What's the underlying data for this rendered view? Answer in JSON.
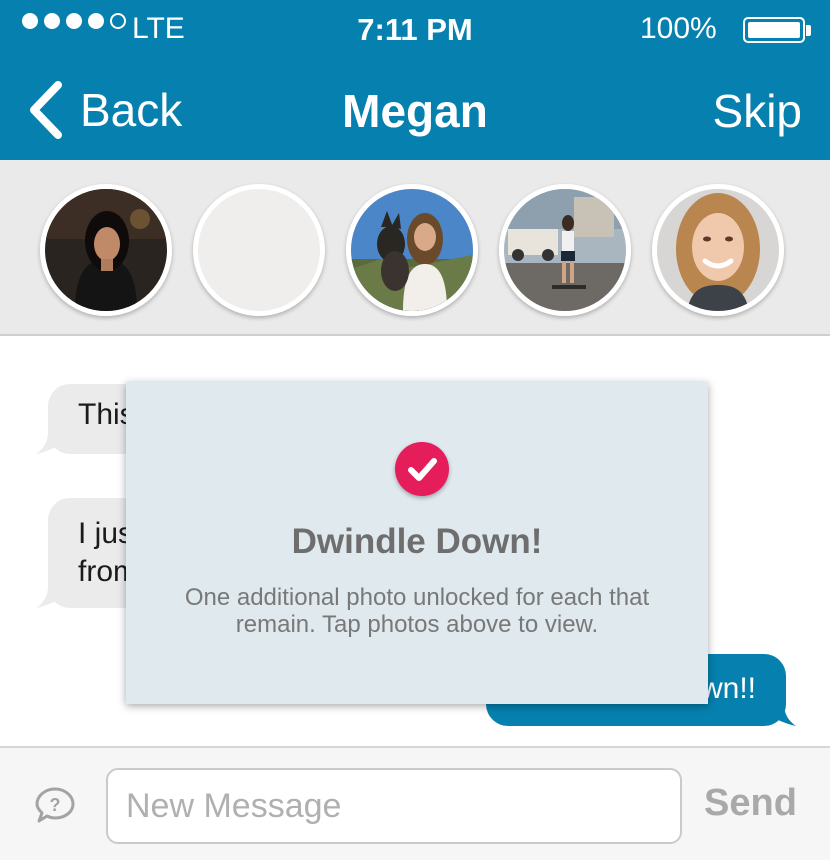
{
  "status_bar": {
    "carrier": "LTE",
    "time": "7:11 PM",
    "battery_percent": "100%",
    "signal_bars_filled": 4,
    "signal_bars_total": 5
  },
  "nav": {
    "back_label": "Back",
    "title": "Megan",
    "skip_label": "Skip"
  },
  "photos": [
    {
      "name": "photo-1",
      "state": "unlocked"
    },
    {
      "name": "photo-2",
      "state": "locked"
    },
    {
      "name": "photo-3",
      "state": "unlocked"
    },
    {
      "name": "photo-4",
      "state": "unlocked"
    },
    {
      "name": "photo-5",
      "state": "unlocked"
    }
  ],
  "messages": [
    {
      "side": "received",
      "text": "This"
    },
    {
      "side": "received",
      "text_line1": "I just",
      "text_line2": "from"
    },
    {
      "side": "sent",
      "text": "wn!!"
    }
  ],
  "modal": {
    "icon": "checkmark-icon",
    "title": "Dwindle Down!",
    "body": "One additional photo unlocked for each that remain. Tap photos above to view."
  },
  "composer": {
    "icon": "speech-bubble-question-icon",
    "placeholder": "New Message",
    "value": "",
    "send_label": "Send"
  },
  "colors": {
    "header": "#0680ae",
    "sent_bubble": "#0680ae",
    "received_bubble": "#ebebeb",
    "modal_background": "#dfe9ee",
    "check_badge": "#e51d5a"
  }
}
